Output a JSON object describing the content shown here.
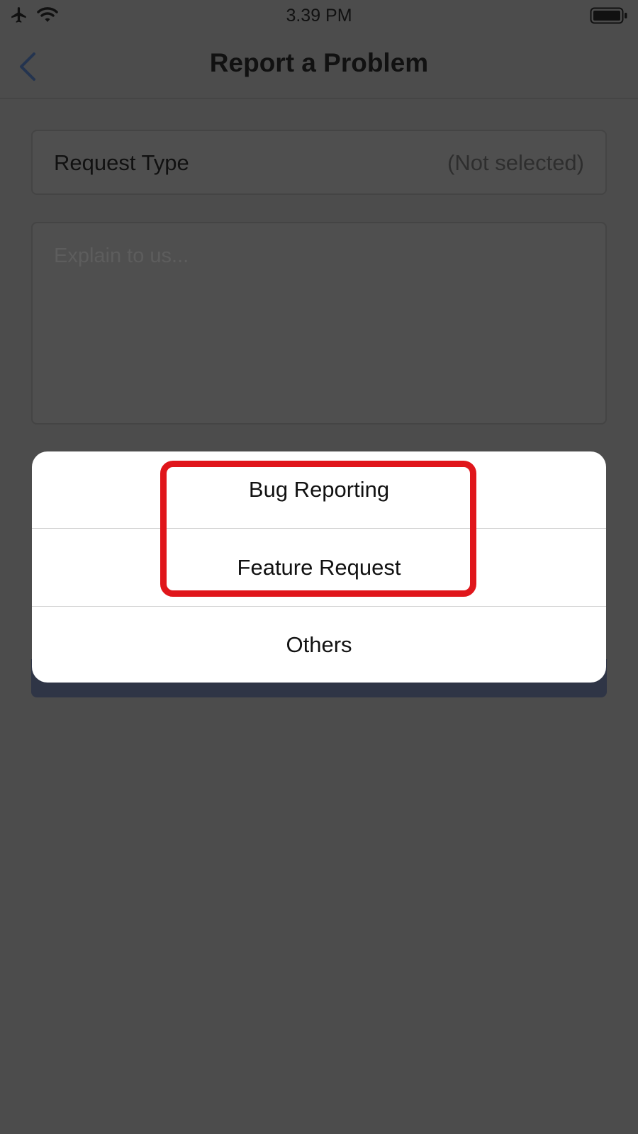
{
  "status_bar": {
    "time": "3.39 PM",
    "icons": [
      "airplane-icon",
      "wifi-icon",
      "battery-icon"
    ]
  },
  "nav": {
    "back_icon": "chevron-left-icon",
    "title": "Report a Problem"
  },
  "form": {
    "request_type_label": "Request Type",
    "request_type_value": "(Not selected)",
    "explain_placeholder": "Explain to us..."
  },
  "action_sheet": {
    "options": [
      {
        "label": "Bug Reporting"
      },
      {
        "label": "Feature Request"
      },
      {
        "label": "Others"
      }
    ]
  },
  "colors": {
    "backdrop": "#4c4c4c",
    "sheet": "#ffffff",
    "highlight": "#e0161b",
    "back_arrow": "#24344f",
    "submit_button": "#2f3546"
  }
}
